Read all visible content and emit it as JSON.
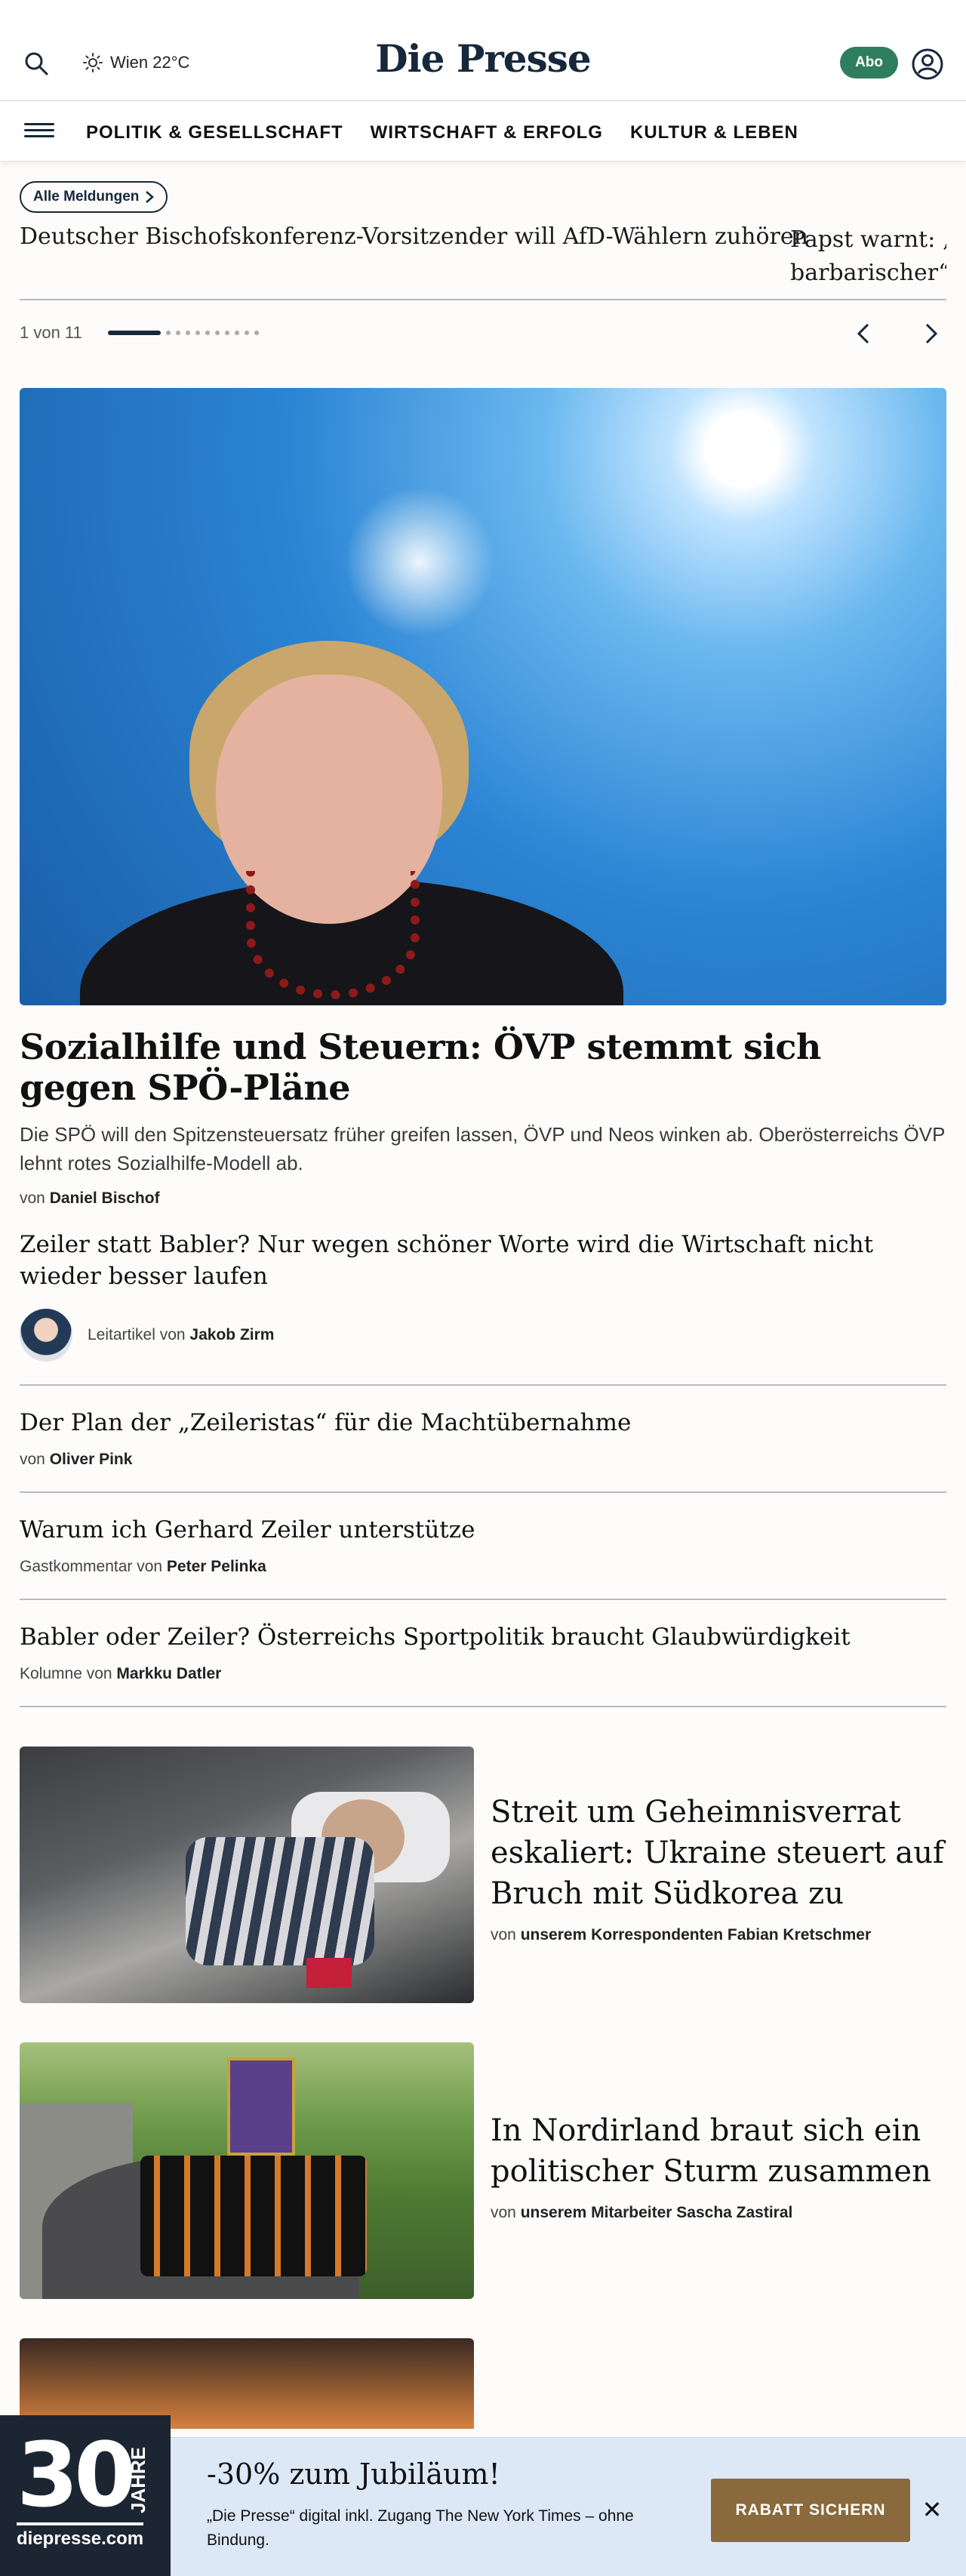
{
  "header": {
    "logo": "Die Presse",
    "weather": "Wien 22°C",
    "abo_label": "Abo"
  },
  "nav": {
    "items": [
      "POLITIK & GESELLSCHAFT",
      "WIRTSCHAFT & ERFOLG",
      "KULTUR & LEBEN"
    ]
  },
  "ticker": {
    "button_label": "Alle Meldungen",
    "items": [
      "Deutscher Bischofskonferenz-Vorsitzender will AfD-Wählern zuhören",
      "Papst warnt: „B",
      "barbarischer“"
    ],
    "pager_count": "1 von 11",
    "total": 11,
    "current": 1
  },
  "hero": {
    "title": "Sozialhilfe und Steuern: ÖVP stemmt sich gegen SPÖ-Pläne",
    "lead": "Die SPÖ will den Spitzensteuersatz früher greifen lassen, ÖVP und Neos winken ab. Oberösterreichs ÖVP lehnt rotes Sozialhilfe-Modell ab.",
    "byline_prefix": "von",
    "author": "Daniel Bischof"
  },
  "articles": [
    {
      "title": "Zeiler statt Babler? Nur wegen schöner Worte wird die Wirtschaft nicht wieder besser laufen",
      "prefix": "Leitartikel von",
      "author": "Jakob Zirm"
    },
    {
      "title": "Der Plan der „Zeileristas“ für die Machtübernahme",
      "prefix": "von",
      "author": "Oliver Pink"
    },
    {
      "title": "Warum ich Gerhard Zeiler unterstütze",
      "prefix": "Gastkommentar von",
      "author": "Peter Pelinka"
    },
    {
      "title": "Babler oder Zeiler? Österreichs Sportpolitik braucht Glaubwürdigkeit",
      "prefix": "Kolumne von",
      "author": "Markku Datler"
    }
  ],
  "teasers": [
    {
      "title": "Streit um Geheimnisverrat eskaliert: Ukraine steuert auf Bruch mit Südkorea zu",
      "prefix": "von",
      "author": "unserem Korrespondenten Fabian Kretschmer"
    },
    {
      "title": "In Nordirland braut sich ein politischer Sturm zusammen",
      "prefix": "von",
      "author": "unserem Mitarbeiter Sascha Zastiral"
    }
  ],
  "promo": {
    "badge_number": "30",
    "badge_word": "JAHRE",
    "badge_site": "diepresse.com",
    "title": "-30% zum Jubiläum!",
    "text": "„Die Presse“ digital inkl. Zugang The New York Times – ohne Bindung.",
    "cta": "RABATT SICHERN",
    "close": "✕"
  },
  "colors": {
    "brand": "#16283c",
    "abo": "#2f7d5f",
    "cta": "#8a6a3c",
    "promo_bg": "#dde8f7"
  }
}
